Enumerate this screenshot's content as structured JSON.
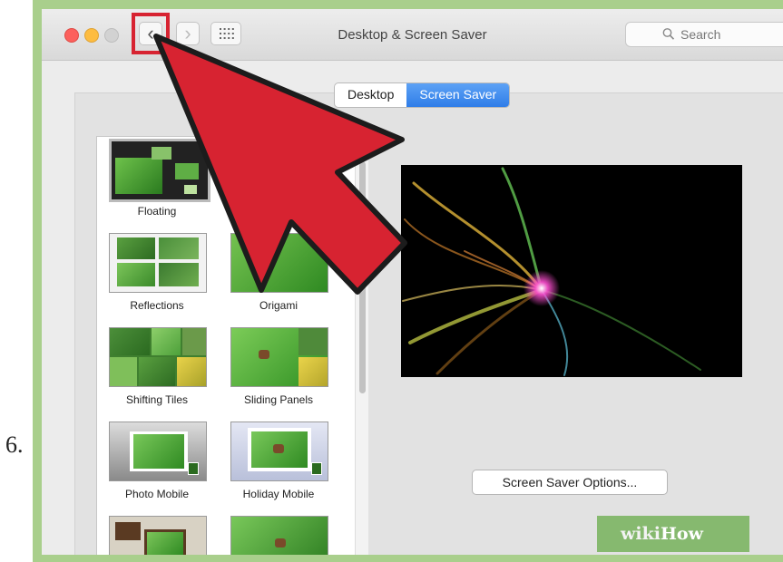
{
  "step_number": "6.",
  "window": {
    "title": "Desktop & Screen Saver",
    "search_placeholder": "Search",
    "back_glyph": "‹",
    "forward_glyph": "›"
  },
  "tabs": [
    {
      "label": "Desktop",
      "active": false
    },
    {
      "label": "Screen Saver",
      "active": true
    }
  ],
  "screensavers": [
    {
      "label": "Floating",
      "selected": true
    },
    {
      "label": "Reflections",
      "selected": false
    },
    {
      "label": "Origami",
      "selected": false
    },
    {
      "label": "Shifting Tiles",
      "selected": false
    },
    {
      "label": "Sliding Panels",
      "selected": false
    },
    {
      "label": "Photo Mobile",
      "selected": false
    },
    {
      "label": "Holiday Mobile",
      "selected": false
    },
    {
      "label": "",
      "selected": false
    },
    {
      "label": "",
      "selected": false
    }
  ],
  "options_button": "Screen Saver Options...",
  "watermark": {
    "wiki": "wiki",
    "how": "How"
  },
  "colors": {
    "annotation_red": "#d72331",
    "frame_green": "#a9cf8c",
    "accent_blue": "#2f7de8"
  }
}
